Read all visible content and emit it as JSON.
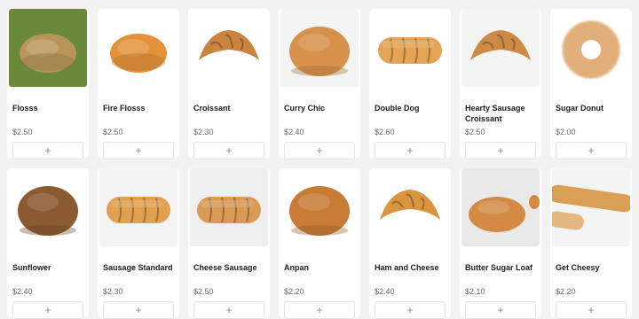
{
  "products": [
    {
      "name": "Flosss",
      "price": "$2.50",
      "add": "+",
      "image": "flosss-bread-photo",
      "bg": "#6a8a3a",
      "color": "#b9955a",
      "shape": "fluffy"
    },
    {
      "name": "Fire Flosss",
      "price": "$2.50",
      "add": "+",
      "image": "fire-flosss-bread-photo",
      "bg": "#ffffff",
      "color": "#e3923a",
      "shape": "fluffy"
    },
    {
      "name": "Croissant",
      "price": "$2.30",
      "add": "+",
      "image": "croissant-photo",
      "bg": "#ffffff",
      "color": "#c98440",
      "shape": "croissant"
    },
    {
      "name": "Curry Chic",
      "price": "$2.40",
      "add": "+",
      "image": "curry-chic-bun-photo",
      "bg": "#f4f4f4",
      "color": "#d6914a",
      "shape": "bun"
    },
    {
      "name": "Double Dog",
      "price": "$2.60",
      "add": "+",
      "image": "double-dog-bread-photo",
      "bg": "#ffffff",
      "color": "#e2a556",
      "shape": "roll"
    },
    {
      "name": "Hearty Sausage Croissant",
      "price": "$2.50",
      "add": "+",
      "image": "hearty-sausage-croissant-photo",
      "bg": "#f4f4f4",
      "color": "#cc8b45",
      "shape": "croissant"
    },
    {
      "name": "Sugar Donut",
      "price": "$2.00",
      "add": "+",
      "image": "sugar-donut-photo",
      "bg": "#ffffff",
      "color": "#e1b07a",
      "shape": "donut"
    },
    {
      "name": "Sunflower",
      "price": "$2.40",
      "add": "+",
      "image": "sunflower-bread-photo",
      "bg": "#ffffff",
      "color": "#8a5a30",
      "shape": "bun"
    },
    {
      "name": "Sausage Standard",
      "price": "$2.30",
      "add": "+",
      "image": "sausage-standard-bread-photo",
      "bg": "#f4f4f4",
      "color": "#e0a050",
      "shape": "roll"
    },
    {
      "name": "Cheese Sausage",
      "price": "$2.50",
      "add": "+",
      "image": "cheese-sausage-bread-photo",
      "bg": "#efefef",
      "color": "#d99a55",
      "shape": "roll"
    },
    {
      "name": "Anpan",
      "price": "$2.20",
      "add": "+",
      "image": "anpan-bun-photo",
      "bg": "#ffffff",
      "color": "#c77b35",
      "shape": "bun"
    },
    {
      "name": "Ham and Cheese",
      "price": "$2.40",
      "add": "+",
      "image": "ham-and-cheese-bread-photo",
      "bg": "#ffffff",
      "color": "#d9953f",
      "shape": "croissant"
    },
    {
      "name": "Butter Sugar Loaf",
      "price": "$2.10",
      "add": "+",
      "image": "butter-sugar-loaf-photo",
      "bg": "#e9e9e9",
      "color": "#d28a45",
      "shape": "loaf"
    },
    {
      "name": "Get Cheesy",
      "price": "$2.20",
      "add": "+",
      "image": "get-cheesy-bread-photo",
      "bg": "#f4f4f4",
      "color": "#d9a055",
      "shape": "stick"
    }
  ]
}
